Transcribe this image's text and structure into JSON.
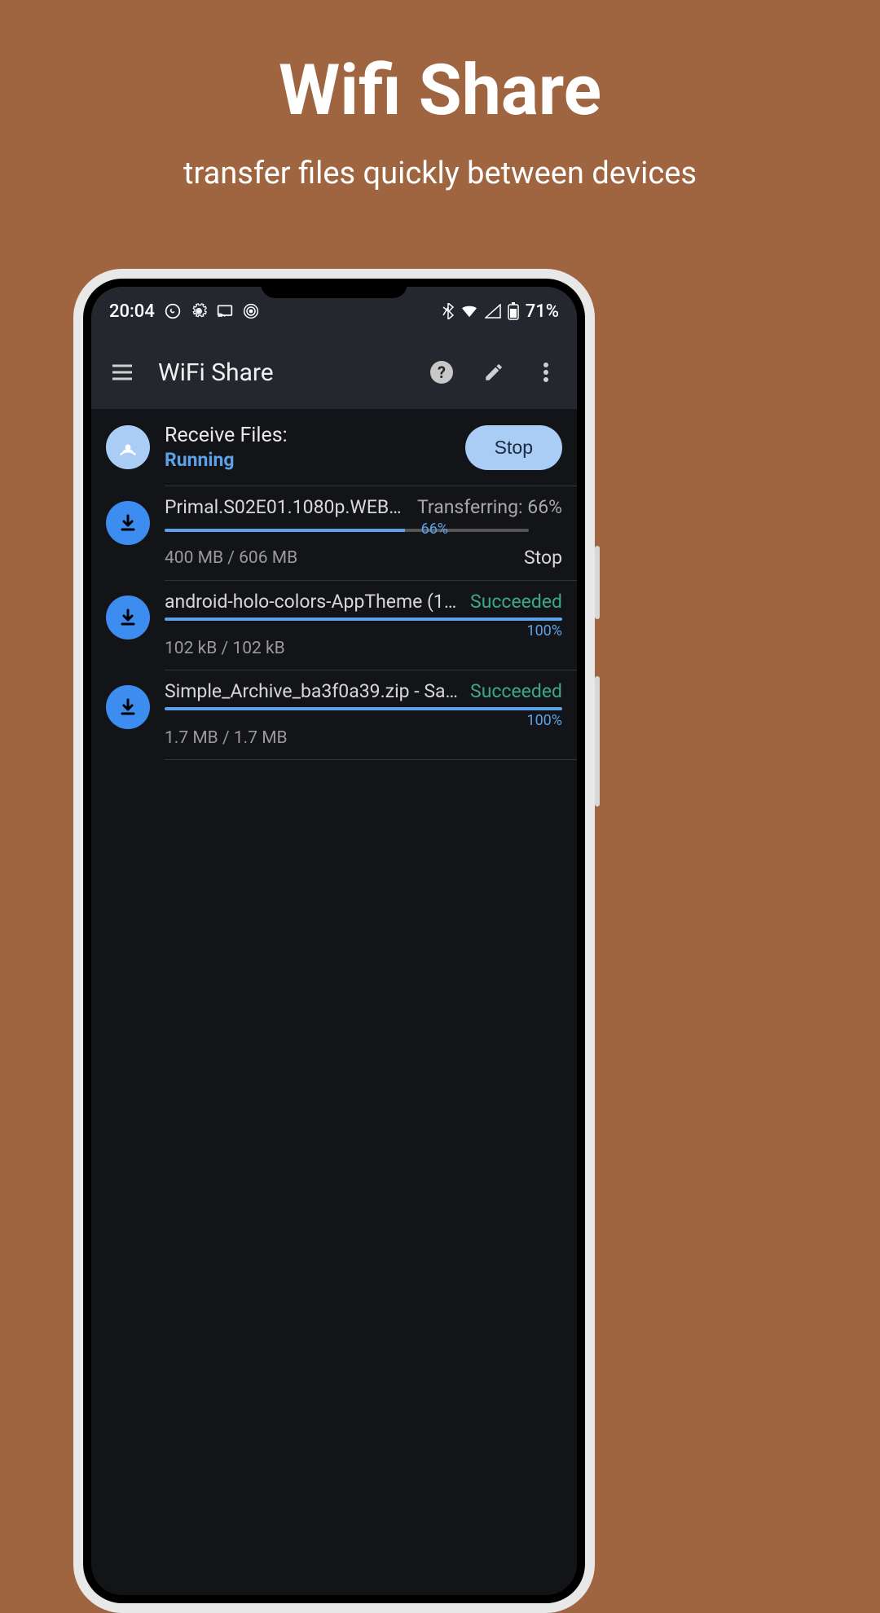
{
  "promo": {
    "title": "Wifi Share",
    "subtitle": "transfer files quickly between devices"
  },
  "status_bar": {
    "time": "20:04",
    "battery": "71%"
  },
  "app_bar": {
    "title": "WiFi Share"
  },
  "receive": {
    "label": "Receive Files:",
    "status": "Running",
    "button": "Stop"
  },
  "transfers": [
    {
      "name": "Primal.S02E01.1080p.WEBRip.x…",
      "status": "Transferring: 66%",
      "status_type": "progress",
      "progress": 66,
      "progress_label": "66%",
      "size": "400 MB / 606 MB",
      "action": "Stop"
    },
    {
      "name": "android-holo-colors-AppTheme (1).zip.…",
      "status": "Succeeded",
      "status_type": "success",
      "progress": 100,
      "progress_label": "100%",
      "size": "102 kB / 102 kB",
      "action": ""
    },
    {
      "name": "Simple_Archive_ba3f0a39.zip - Samsu…",
      "status": "Succeeded",
      "status_type": "success",
      "progress": 100,
      "progress_label": "100%",
      "size": "1.7 MB / 1.7 MB",
      "action": ""
    }
  ]
}
